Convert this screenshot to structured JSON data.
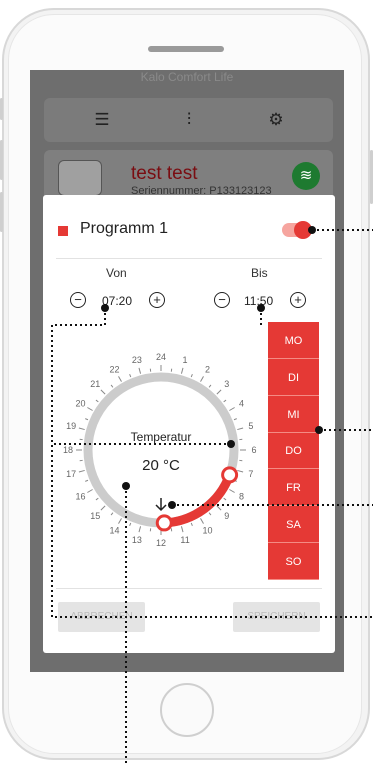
{
  "background": {
    "app_title": "Kalo Comfort Life",
    "toolbar_icons": [
      "list-icon",
      "sliders-icon",
      "gear-icon"
    ],
    "device": {
      "name": "test test",
      "serial": "Seriennummer: P133123123"
    }
  },
  "modal": {
    "title": "Programm 1",
    "enabled": true,
    "from_label": "Von",
    "to_label": "Bis",
    "from_time": "07:20",
    "to_time": "11:50",
    "minus_symbol": "−",
    "plus_symbol": "+",
    "dial": {
      "label": "Temperatur",
      "value": "20 °C",
      "hours": [
        "24",
        "1",
        "2",
        "3",
        "4",
        "5",
        "6",
        "7",
        "8",
        "9",
        "10",
        "11",
        "12",
        "13",
        "14",
        "15",
        "16",
        "17",
        "18",
        "19",
        "20",
        "21",
        "22",
        "23"
      ],
      "arc_start_hour": 7.33,
      "arc_end_hour": 11.83
    },
    "days": [
      "MO",
      "DI",
      "MI",
      "DO",
      "FR",
      "SA",
      "SO"
    ],
    "cancel_label": "ABBRECHEN",
    "save_label": "SPEICHERN"
  },
  "colors": {
    "accent": "#e53935",
    "accent_light": "#f6a59f",
    "dial_ring": "#cccccc",
    "overlay": "#6e6e6e"
  }
}
